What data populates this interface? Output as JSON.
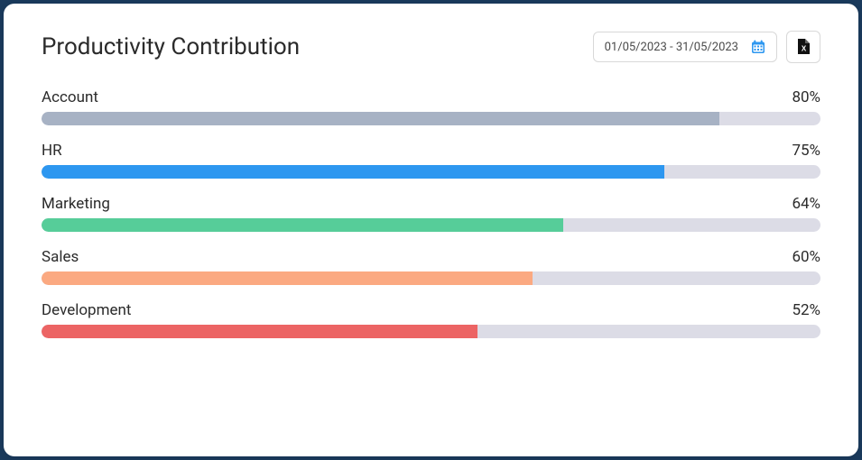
{
  "header": {
    "title": "Productivity Contribution",
    "date_range": "01/05/2023 - 31/05/2023"
  },
  "chart_data": {
    "type": "bar",
    "title": "Productivity Contribution",
    "xlabel": "",
    "ylabel": "",
    "ylim": [
      0,
      100
    ],
    "categories": [
      "Account",
      "HR",
      "Marketing",
      "Sales",
      "Development"
    ],
    "values": [
      80,
      75,
      64,
      60,
      52
    ],
    "colors": [
      "#a7b2c4",
      "#2d97f0",
      "#56cd99",
      "#fba981",
      "#ec6464"
    ]
  },
  "bars": [
    {
      "label": "Account",
      "value": 80,
      "display": "80%",
      "color": "#a7b2c4",
      "width": "87%"
    },
    {
      "label": "HR",
      "value": 75,
      "display": "75%",
      "color": "#2d97f0",
      "width": "80%"
    },
    {
      "label": "Marketing",
      "value": 64,
      "display": "64%",
      "color": "#56cd99",
      "width": "67%"
    },
    {
      "label": "Sales",
      "value": 60,
      "display": "60%",
      "color": "#fba981",
      "width": "63%"
    },
    {
      "label": "Development",
      "value": 52,
      "display": "52%",
      "color": "#ec6464",
      "width": "56%"
    }
  ]
}
